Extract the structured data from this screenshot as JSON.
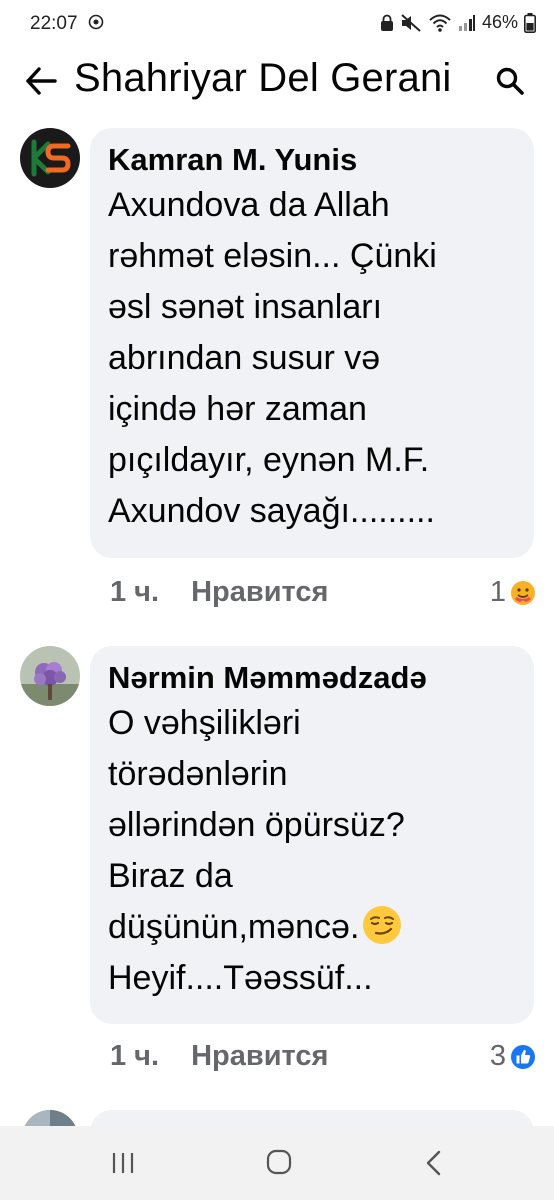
{
  "status_bar": {
    "time": "22:07",
    "battery": "46%"
  },
  "header": {
    "title": "Shahriyar Del Gerani"
  },
  "comments": [
    {
      "author": "Kamran M. Yunis",
      "text": "Axundova da Allah\nrəhmət eləsin... Çünki\nəsl sənət insanları\nabrından susur və\niçində hər zaman\npıçıldayır, eynən M.F.\nAxundov sayağı.........",
      "time": "1 ч.",
      "like_label": "Нравится",
      "reaction_count": "1",
      "reaction_icon": "care-icon"
    },
    {
      "author": "Nərmin Məmmədzadə",
      "text_before_emoji": "O vəhşilikləri\ntörədənlərin\nəllərindən öpürsüz?\nBiraz da\ndüşünün,məncə.",
      "text_after_emoji": "\nHeyif....Təəssüf...",
      "time": "1 ч.",
      "like_label": "Нравится",
      "reaction_count": "3",
      "reaction_icon": "like-icon"
    }
  ],
  "colors": {
    "bubble": "#f0f2f5",
    "meta": "#65676b",
    "like_blue": "#1877f2"
  }
}
